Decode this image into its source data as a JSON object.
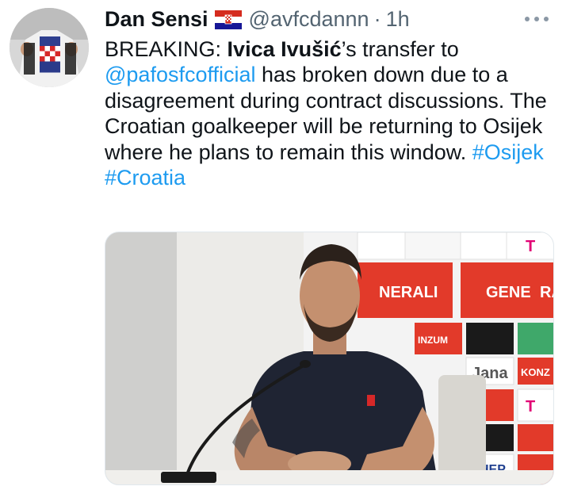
{
  "user": {
    "name": "Dan Sensi",
    "flag_icon": "croatia-flag-icon",
    "handle": "@avfcdannn",
    "separator": "·",
    "time": "1h"
  },
  "menu": {
    "more_icon": "more-options-icon"
  },
  "tweet": {
    "t1": "BREAKING: ",
    "t2": "Ivica Ivušić",
    "t3": "’s transfer to ",
    "mention": "@pafosfcofficial",
    "t4": " has broken down due to a disagreement during contract discussions. The Croatian goalkeeper will be returning to Osijek where he plans to remain this window. ",
    "hashtag1": "#Osijek",
    "t5": " ",
    "hashtag2": "#Croatia"
  },
  "media": {
    "sponsor_1": "NERALI",
    "sponsor_2": "GENE",
    "sponsor_3": "RA",
    "sponsor_4": "Jana",
    "sponsor_5": "KONZ",
    "sponsor_6": "HEP",
    "sponsor_7": "T",
    "sponsor_8": "INZUM"
  },
  "colors": {
    "link": "#1d9bf0",
    "secondary_text": "#536471",
    "primary_text": "#0f1419"
  }
}
